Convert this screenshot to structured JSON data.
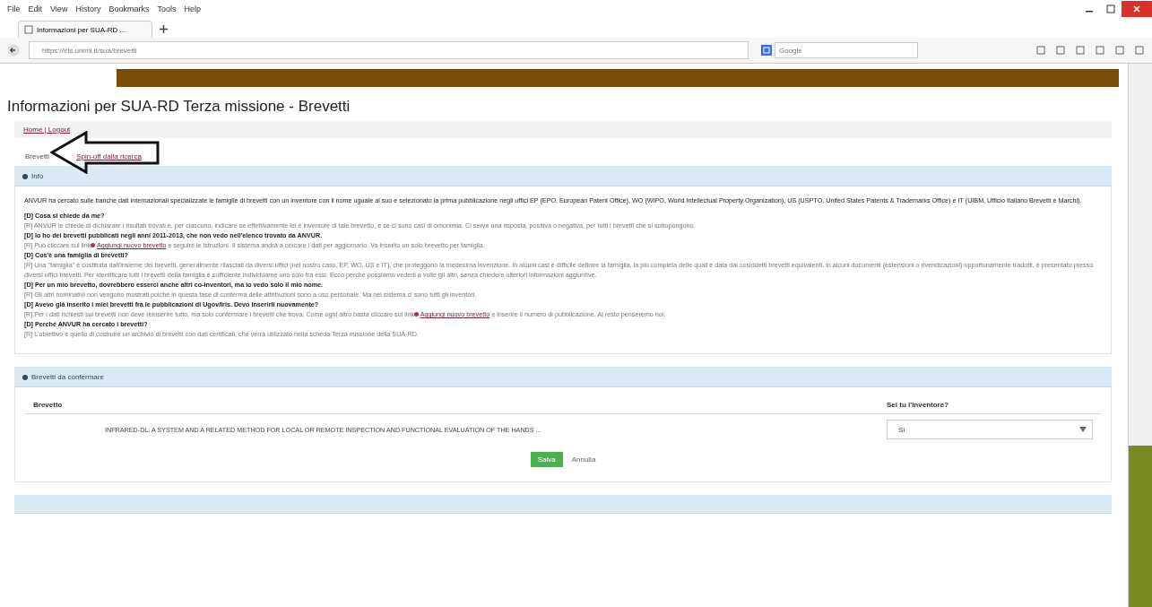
{
  "browser": {
    "menu": [
      "File",
      "Edit",
      "View",
      "History",
      "Bookmarks",
      "Tools",
      "Help"
    ],
    "tab_title": "Informazioni per SUA-RD ...",
    "url": "https://iris.unimi.it/sua/brevetti",
    "search_placeholder": "Google"
  },
  "page": {
    "title": "Informazioni per SUA-RD Terza missione - Brevetti",
    "breadcrumb": "Home | Logout",
    "tabs": [
      {
        "label": "Brevetti",
        "selected": true
      },
      {
        "label": "Spin-off dalla ricerca",
        "selected": false
      }
    ],
    "info": {
      "header": "Info",
      "intro": "ANVUR ha cercato sulle banche dati internazionali specializzate le famiglie di brevetti con un inventore con il nome uguale al suo e selezionato la prima pubblicazione negli uffici EP (EPO, European Patent Office), WO (WIPO, World Intellectual Property Organization), US (USPTO, United States Patents & Trademarks Office) e IT (UIBM, Ufficio Italiano Brevetti e Marchi).",
      "faq": [
        {
          "question": "[D] Cosa si chiede da me?",
          "answer": "[R] ANVUR le chiede di dichiarare i risultati trovati e, per ciascuno, indicare se effettivamente lei è inventore di tale brevetto, e se ci sono casi di omonimia. Ci serve una risposta, positiva o negativa, per tutti i brevetti che si sottopongono."
        },
        {
          "question": "[D] Io ho dei brevetti pubblicati negli anni 2011-2013, che non vedo nell'elenco trovato da ANVUR.",
          "answer": "[R] Può cliccare sul link",
          "link": "Aggiungi nuovo brevetto",
          "answer_after": "e seguire le istruzioni. Il sistema andrà a cercare i dati per aggiornarlo. Va inserito un solo brevetto per famiglia."
        },
        {
          "question": "[D] Cos'è una famiglia di brevetti?",
          "answer": "[R] Una \"famiglia\" è costituita dall'insieme dei brevetti, generalmente rilasciati da diversi uffici (nel nostro caso, EP, WO, US e IT), che proteggono la medesima invenzione. In alcuni casi è difficile definire la famiglia, la più completa delle quali è data dai cosiddetti brevetti equivalenti, in alcuni documenti (estensioni o rivendicazioni) opportunamente tradotti, è presentato presso diversi uffici brevetti. Per identificare tutti i brevetti della famiglia è sufficiente individuarne uno solo tra essi. Ecco perché possiamo vederli a volte gli altri, senza chiedere ulteriori informazioni aggiuntive."
        },
        {
          "question": "[D] Per un mio brevetto, dovrebbero esserci anche altri co-inventori, ma io vedo solo il mio nome.",
          "answer": "[R] Gli altri nominativi non vengono mostrati poiché in questa fase di conferma delle attribuzioni sono a uso personale. Ma nel sistema ci sono tutti gli inventori."
        },
        {
          "question": "[D] Avevo già inserito i miei brevetti fra le pubblicazioni di Ugov/Iris. Devo inserirli nuovamente?",
          "answer": "[R] Per i dati richiesti sui brevetti non deve reinserire tutto, ma solo confermare i brevetti che trova. Come ogni altro basta cliccare sul link",
          "link": "Aggiungi nuovo brevetto",
          "answer_after": "e inserire il numero di pubblicazione. Al resto penseremo noi."
        },
        {
          "question": "[D] Perché ANVUR ha cercato i brevetti?",
          "answer": "[R] L'obiettivo è quello di costruire un archivio di brevetti con dati certificati, che verrà utilizzato nella scheda Terza missione della SUA-RD."
        }
      ]
    },
    "confirm": {
      "header": "Brevetti da confermare",
      "columns": [
        "Brevetto",
        "Sei tu l'inventore?"
      ],
      "rows": [
        {
          "title": "INFRARED-DL: A SYSTEM AND A RELATED METHOD FOR LOCAL OR REMOTE INSPECTION AND FUNCTIONAL EVALUATION OF THE HANDS ...",
          "answer": "Sì"
        }
      ],
      "buttons": [
        {
          "label": "Salva",
          "kind": "primary"
        },
        {
          "label": "Annulla",
          "kind": "link"
        }
      ]
    }
  }
}
